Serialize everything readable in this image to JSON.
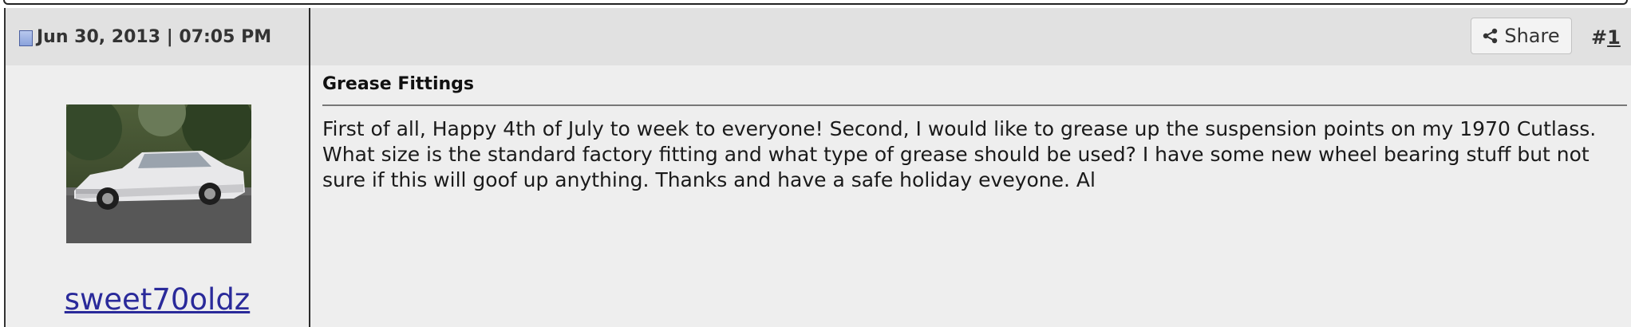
{
  "post": {
    "date": "Jun 30, 2013 | 07:05 PM",
    "share_label": "Share",
    "number_prefix": "#",
    "number": "1",
    "title": "Grease Fittings",
    "body": "First of all, Happy 4th of July to week to everyone! Second, I would like to grease up the suspension points on my 1970 Cutlass. What size is the standard factory fitting and what type of grease should be used? I have some new wheel bearing stuff but not sure if this will goof up anything. Thanks and have a safe holiday eveyone. Al"
  },
  "user": {
    "username": "sweet70oldz"
  },
  "icons": {
    "post_icon": "document-icon",
    "share_icon": "share-icon"
  },
  "colors": {
    "header_bg": "#e1e1e1",
    "post_bg": "#eeeeee",
    "username_link": "#2a2a9a"
  }
}
